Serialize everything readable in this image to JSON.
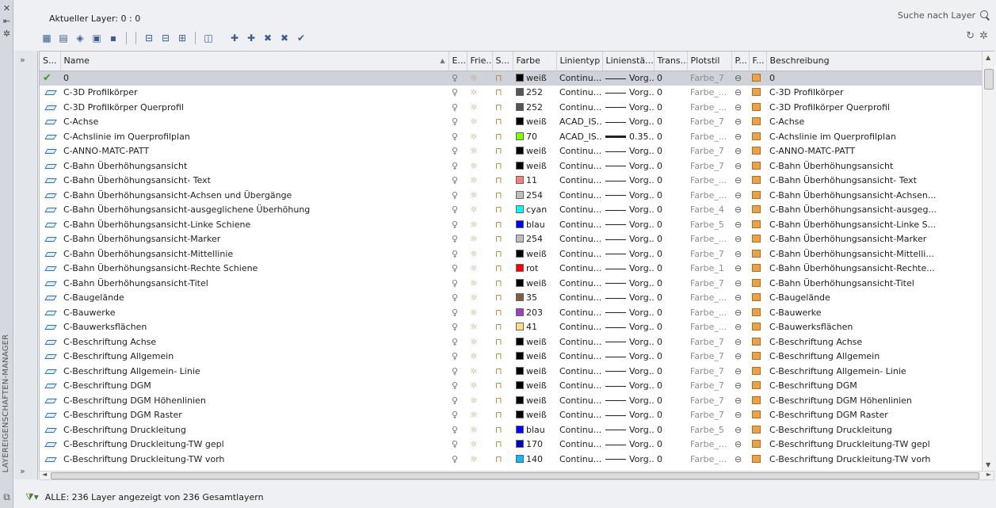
{
  "palette": {
    "title": "LAYEREIGENSCHAFTEN-MANAGER",
    "close_glyph": "✕",
    "autohide_glyph": "⇤",
    "props_glyph": "✲"
  },
  "header": {
    "current_layer": "Aktueller Layer: 0 : 0",
    "search_placeholder": "Suche nach Layer"
  },
  "columns": [
    "S...",
    "Name",
    "E...",
    "Frie...",
    "S...",
    "Farbe",
    "Linientyp",
    "Linienstä...",
    "Trans...",
    "Plotstil",
    "P...",
    "F...",
    "Beschreibung"
  ],
  "rows": [
    {
      "status": "current",
      "name": "0",
      "color_name": "weiß",
      "color_hex": "#000000",
      "linetype": "Continu...",
      "lw": "Vorg...",
      "lw_thick": false,
      "trans": "0",
      "plotstyle": "Farbe_7",
      "desc": "0",
      "selected": true
    },
    {
      "status": "layer",
      "name": "C-3D Profilkörper",
      "color_name": "252",
      "color_hex": "#555555",
      "linetype": "Continu...",
      "lw": "Vorg...",
      "lw_thick": false,
      "trans": "0",
      "plotstyle": "Farbe_...",
      "desc": "C-3D Profilkörper"
    },
    {
      "status": "layer",
      "name": "C-3D Profilkörper Querprofil",
      "color_name": "252",
      "color_hex": "#555555",
      "linetype": "Continu...",
      "lw": "Vorg...",
      "lw_thick": false,
      "trans": "0",
      "plotstyle": "Farbe_...",
      "desc": "C-3D Profilkörper Querprofil"
    },
    {
      "status": "layer",
      "name": "C-Achse",
      "color_name": "weiß",
      "color_hex": "#000000",
      "linetype": "ACAD_IS...",
      "lw": "Vorg...",
      "lw_thick": false,
      "trans": "0",
      "plotstyle": "Farbe_7",
      "desc": "C-Achse"
    },
    {
      "status": "layer",
      "name": "C-Achslinie im Querprofilplan",
      "color_name": "70",
      "color_hex": "#7fff00",
      "linetype": "ACAD_IS...",
      "lw": "0.35...",
      "lw_thick": true,
      "trans": "0",
      "plotstyle": "Farbe_...",
      "desc": "C-Achslinie im Querprofilplan"
    },
    {
      "status": "layer",
      "name": "C-ANNO-MATC-PATT",
      "color_name": "weiß",
      "color_hex": "#000000",
      "linetype": "Continu...",
      "lw": "Vorg...",
      "lw_thick": false,
      "trans": "0",
      "plotstyle": "Farbe_7",
      "desc": "C-ANNO-MATC-PATT"
    },
    {
      "status": "layer",
      "name": "C-Bahn Überhöhungsansicht",
      "color_name": "weiß",
      "color_hex": "#000000",
      "linetype": "Continu...",
      "lw": "Vorg...",
      "lw_thick": false,
      "trans": "0",
      "plotstyle": "Farbe_7",
      "desc": "C-Bahn Überhöhungsansicht"
    },
    {
      "status": "layer",
      "name": "C-Bahn Überhöhungsansicht- Text",
      "color_name": "11",
      "color_hex": "#ff7f7f",
      "linetype": "Continu...",
      "lw": "Vorg...",
      "lw_thick": false,
      "trans": "0",
      "plotstyle": "Farbe_...",
      "desc": "C-Bahn Überhöhungsansicht- Text"
    },
    {
      "status": "layer",
      "name": "C-Bahn Überhöhungsansicht-Achsen und Übergänge",
      "color_name": "254",
      "color_hex": "#bebebe",
      "linetype": "Continu...",
      "lw": "Vorg...",
      "lw_thick": false,
      "trans": "0",
      "plotstyle": "Farbe_...",
      "desc": "C-Bahn  Überhöhungsansicht-Achsen..."
    },
    {
      "status": "layer",
      "name": "C-Bahn Überhöhungsansicht-ausgeglichene Überhöhung",
      "color_name": "cyan",
      "color_hex": "#00ffff",
      "linetype": "Continu...",
      "lw": "Vorg...",
      "lw_thick": false,
      "trans": "0",
      "plotstyle": "Farbe_4",
      "desc": "C-Bahn  Überhöhungsansicht-ausgeg..."
    },
    {
      "status": "layer",
      "name": "C-Bahn Überhöhungsansicht-Linke Schiene",
      "color_name": "blau",
      "color_hex": "#0000ff",
      "linetype": "Continu...",
      "lw": "Vorg...",
      "lw_thick": false,
      "trans": "0",
      "plotstyle": "Farbe_5",
      "desc": "C-Bahn Überhöhungsansicht-Linke S..."
    },
    {
      "status": "layer",
      "name": "C-Bahn Überhöhungsansicht-Marker",
      "color_name": "254",
      "color_hex": "#bebebe",
      "linetype": "Continu...",
      "lw": "Vorg...",
      "lw_thick": false,
      "trans": "0",
      "plotstyle": "Farbe_...",
      "desc": "C-Bahn Überhöhungsansicht-Marker"
    },
    {
      "status": "layer",
      "name": "C-Bahn Überhöhungsansicht-Mittellinie",
      "color_name": "weiß",
      "color_hex": "#000000",
      "linetype": "Continu...",
      "lw": "Vorg...",
      "lw_thick": false,
      "trans": "0",
      "plotstyle": "Farbe_7",
      "desc": "C-Bahn  Überhöhungsansicht-Mittelli..."
    },
    {
      "status": "layer",
      "name": "C-Bahn Überhöhungsansicht-Rechte Schiene",
      "color_name": "rot",
      "color_hex": "#ff0000",
      "linetype": "Continu...",
      "lw": "Vorg...",
      "lw_thick": false,
      "trans": "0",
      "plotstyle": "Farbe_1",
      "desc": "C-Bahn  Überhöhungsansicht-Rechte..."
    },
    {
      "status": "layer",
      "name": "C-Bahn Überhöhungsansicht-Titel",
      "color_name": "weiß",
      "color_hex": "#000000",
      "linetype": "Continu...",
      "lw": "Vorg...",
      "lw_thick": false,
      "trans": "0",
      "plotstyle": "Farbe_7",
      "desc": "C-Bahn Überhöhungsansicht-Titel"
    },
    {
      "status": "layer",
      "name": "C-Baugelände",
      "color_name": "35",
      "color_hex": "#7f5f3f",
      "linetype": "Continu...",
      "lw": "Vorg...",
      "lw_thick": false,
      "trans": "0",
      "plotstyle": "Farbe_...",
      "desc": "C-Baugelände"
    },
    {
      "status": "layer",
      "name": "C-Bauwerke",
      "color_name": "203",
      "color_hex": "#9f3fbf",
      "linetype": "Continu...",
      "lw": "Vorg...",
      "lw_thick": false,
      "trans": "0",
      "plotstyle": "Farbe_...",
      "desc": "C-Bauwerke"
    },
    {
      "status": "layer",
      "name": "C-Bauwerksflächen",
      "color_name": "41",
      "color_hex": "#ffdf7f",
      "linetype": "Continu...",
      "lw": "Vorg...",
      "lw_thick": false,
      "trans": "0",
      "plotstyle": "Farbe_...",
      "desc": "C-Bauwerksflächen"
    },
    {
      "status": "layer",
      "name": "C-Beschriftung Achse",
      "color_name": "weiß",
      "color_hex": "#000000",
      "linetype": "Continu...",
      "lw": "Vorg...",
      "lw_thick": false,
      "trans": "0",
      "plotstyle": "Farbe_7",
      "desc": "C-Beschriftung Achse"
    },
    {
      "status": "layer",
      "name": "C-Beschriftung Allgemein",
      "color_name": "weiß",
      "color_hex": "#000000",
      "linetype": "Continu...",
      "lw": "Vorg...",
      "lw_thick": false,
      "trans": "0",
      "plotstyle": "Farbe_7",
      "desc": "C-Beschriftung Allgemein"
    },
    {
      "status": "layer",
      "name": "C-Beschriftung Allgemein- Linie",
      "color_name": "weiß",
      "color_hex": "#000000",
      "linetype": "Continu...",
      "lw": "Vorg...",
      "lw_thick": false,
      "trans": "0",
      "plotstyle": "Farbe_7",
      "desc": "C-Beschriftung Allgemein- Linie"
    },
    {
      "status": "layer",
      "name": "C-Beschriftung DGM",
      "color_name": "weiß",
      "color_hex": "#000000",
      "linetype": "Continu...",
      "lw": "Vorg...",
      "lw_thick": false,
      "trans": "0",
      "plotstyle": "Farbe_7",
      "desc": "C-Beschriftung DGM"
    },
    {
      "status": "layer",
      "name": "C-Beschriftung DGM Höhenlinien",
      "color_name": "weiß",
      "color_hex": "#000000",
      "linetype": "Continu...",
      "lw": "Vorg...",
      "lw_thick": false,
      "trans": "0",
      "plotstyle": "Farbe_7",
      "desc": "C-Beschriftung DGM Höhenlinien"
    },
    {
      "status": "layer",
      "name": "C-Beschriftung DGM Raster",
      "color_name": "weiß",
      "color_hex": "#000000",
      "linetype": "Continu...",
      "lw": "Vorg...",
      "lw_thick": false,
      "trans": "0",
      "plotstyle": "Farbe_7",
      "desc": "C-Beschriftung DGM Raster"
    },
    {
      "status": "layer",
      "name": "C-Beschriftung Druckleitung",
      "color_name": "blau",
      "color_hex": "#0000ff",
      "linetype": "Continu...",
      "lw": "Vorg...",
      "lw_thick": false,
      "trans": "0",
      "plotstyle": "Farbe_5",
      "desc": "C-Beschriftung Druckleitung"
    },
    {
      "status": "layer",
      "name": "C-Beschriftung Druckleitung-TW gepl",
      "color_name": "170",
      "color_hex": "#0000bf",
      "linetype": "Continu...",
      "lw": "Vorg...",
      "lw_thick": false,
      "trans": "0",
      "plotstyle": "Farbe_...",
      "desc": "C-Beschriftung Druckleitung-TW gepl"
    },
    {
      "status": "layer",
      "name": "C-Beschriftung Druckleitung-TW vorh",
      "color_name": "140",
      "color_hex": "#00bfff",
      "linetype": "Continu...",
      "lw": "Vorg...",
      "lw_thick": false,
      "trans": "0",
      "plotstyle": "Farbe_...",
      "desc": "C-Beschriftung Druckleitung-TW vorh"
    }
  ],
  "statusbar": {
    "text": "ALLE: 236 Layer angezeigt von 236 Gesamtlayern"
  },
  "scroll": {
    "hscroll_label": "III"
  }
}
